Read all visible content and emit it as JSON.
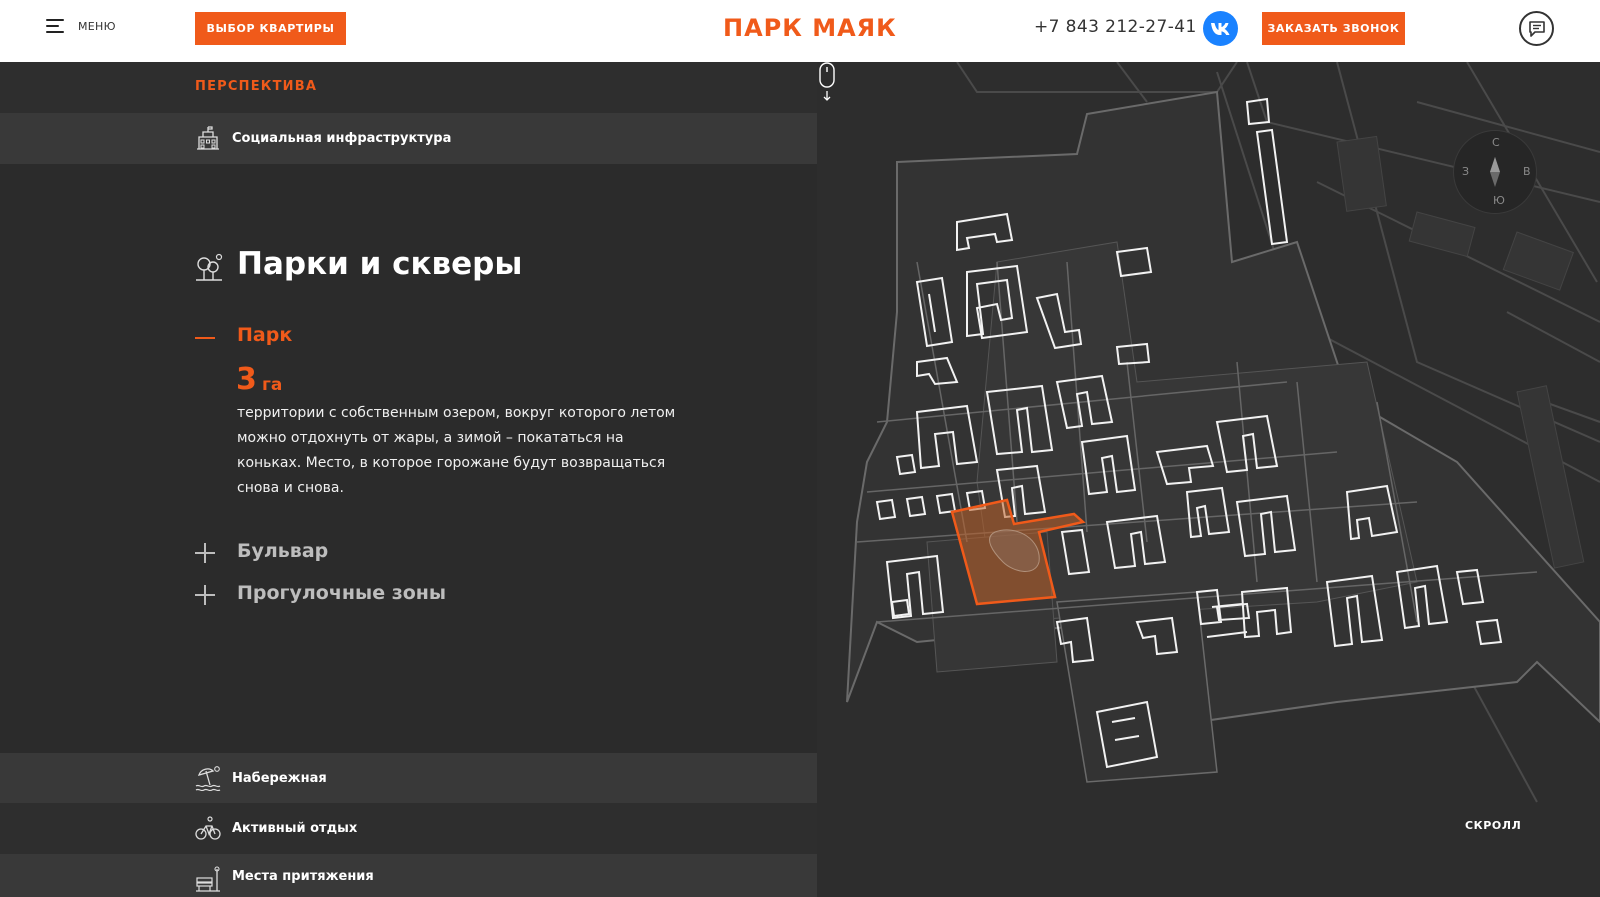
{
  "header": {
    "menu_label": "МЕНЮ",
    "select_button": "ВЫБОР КВАРТИРЫ",
    "logo": "ПАРК МАЯК",
    "phone": "+7 843 212-27-41",
    "vk_label": "VK",
    "call_button": "ЗАКАЗАТЬ ЗВОНОК"
  },
  "panel": {
    "section_label": "ПЕРСПЕКТИВА",
    "infrastructure": "Социальная инфраструктура",
    "title": "Парки и скверы",
    "accordion": [
      {
        "title": "Парк",
        "stat_value": "3",
        "stat_unit": "га",
        "description": "территории с собственным озером, вокруг которого летом можно отдохнуть от жары, а зимой – покататься на коньках. Место, в которое горожане будут возвращаться снова и снова."
      },
      {
        "title": "Бульвар"
      },
      {
        "title": "Прогулочные зоны"
      }
    ],
    "bottom_items": [
      {
        "label": "Набережная",
        "icon": "beach-icon"
      },
      {
        "label": "Активный отдых",
        "icon": "bicycle-icon"
      },
      {
        "label": "Места притяжения",
        "icon": "bench-icon"
      }
    ]
  },
  "map": {
    "compass": {
      "n": "С",
      "s": "Ю",
      "w": "З",
      "e": "В"
    },
    "scroll_label": "СКРОЛЛ"
  },
  "colors": {
    "accent": "#f05a1a",
    "panel_bg": "#2b2b2b",
    "row_bg": "#393939",
    "map_bg": "#2d2d2d"
  }
}
